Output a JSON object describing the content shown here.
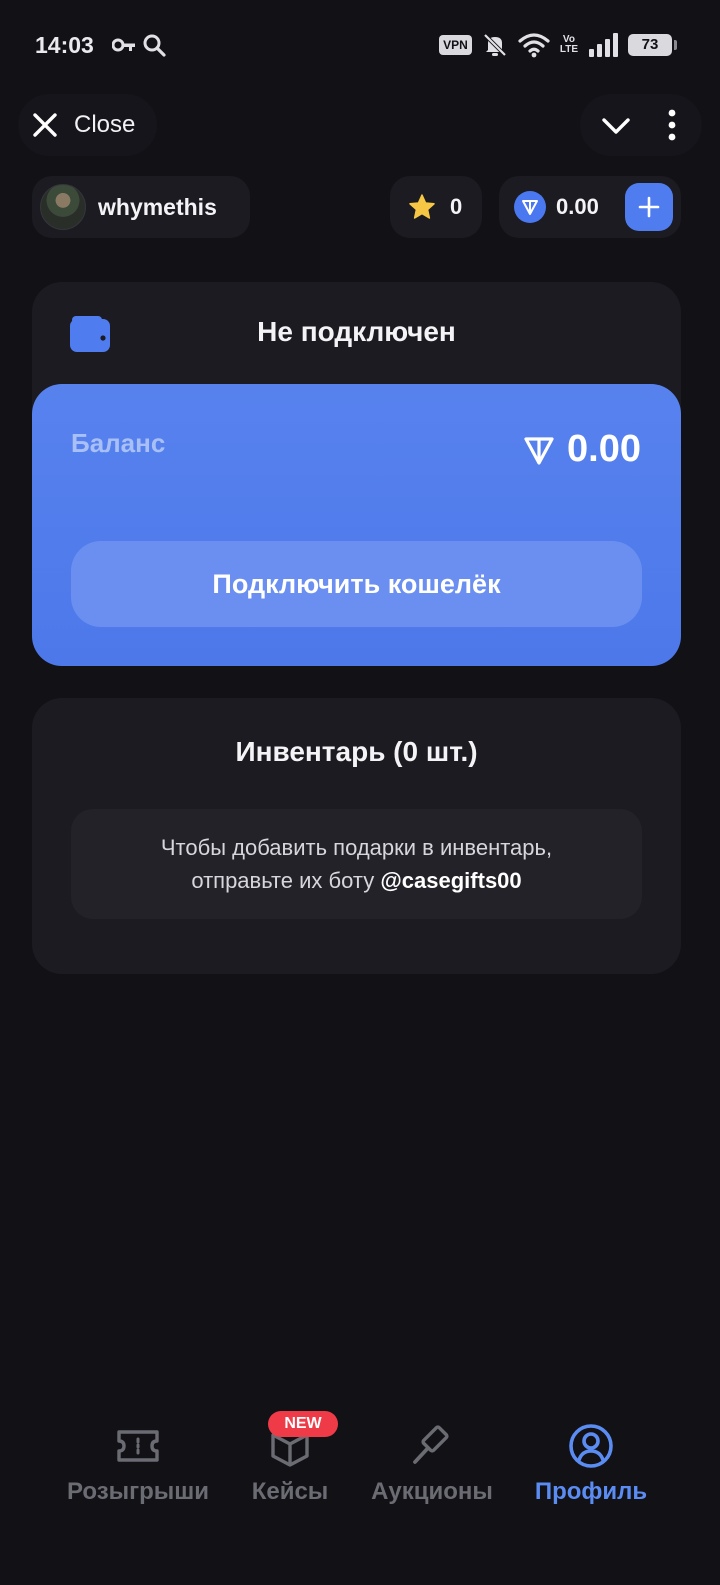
{
  "status_bar": {
    "time": "14:03",
    "vpn": "VPN",
    "volte_top": "Vo",
    "volte_bottom": "LTE",
    "battery": "73"
  },
  "header": {
    "close_label": "Close"
  },
  "user": {
    "username": "whymethis",
    "stars": "0",
    "ton_balance": "0.00"
  },
  "wallet": {
    "status": "Не подключен",
    "balance_label": "Баланс",
    "balance_amount": "0.00",
    "connect_button": "Подключить кошелёк"
  },
  "inventory": {
    "title": "Инвентарь (0 шт.)",
    "note_line1": "Чтобы добавить подарки в инвентарь,",
    "note_line2_prefix": "отправьте их боту ",
    "bot_handle": "@casegifts00"
  },
  "nav": {
    "items": [
      {
        "label": "Розыгрыши",
        "icon": "ticket-icon",
        "active": false
      },
      {
        "label": "Кейсы",
        "icon": "box-icon",
        "active": false,
        "badge": "NEW"
      },
      {
        "label": "Аукционы",
        "icon": "gavel-icon",
        "active": false
      },
      {
        "label": "Профиль",
        "icon": "profile-icon",
        "active": true
      }
    ]
  },
  "colors": {
    "background": "#111116",
    "card": "#1b1b21",
    "accent": "#4f7df0",
    "active_nav": "#5b8cf2",
    "inactive_nav": "#6b6b73",
    "badge": "#ef3a48",
    "star": "#f6c744"
  }
}
